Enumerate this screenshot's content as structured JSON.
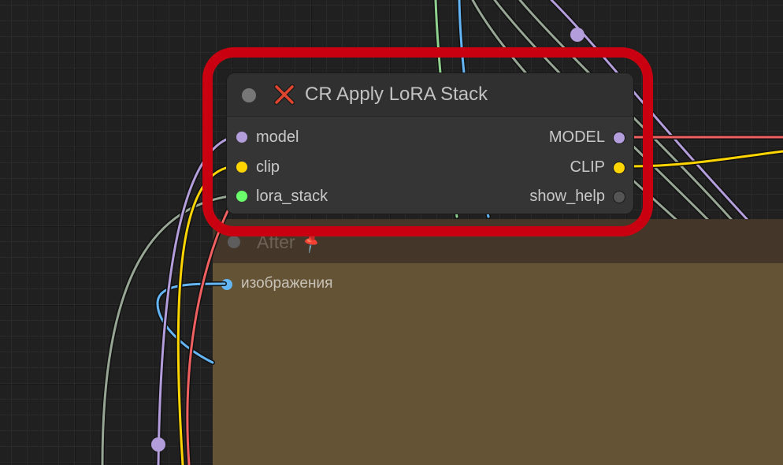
{
  "canvas": {
    "background": "#202020",
    "highlight_color": "#c8000f"
  },
  "node_lora": {
    "title": "CR Apply LoRA Stack",
    "title_icon": "red-x-icon",
    "inputs": [
      {
        "label": "model",
        "color": "#b39ddb"
      },
      {
        "label": "clip",
        "color": "#ffd500"
      },
      {
        "label": "lora_stack",
        "color": "#6bff6b"
      }
    ],
    "outputs": [
      {
        "label": "MODEL",
        "color": "#b39ddb"
      },
      {
        "label": "CLIP",
        "color": "#ffd500"
      },
      {
        "label": "show_help",
        "color": "#555555"
      }
    ]
  },
  "node_after": {
    "title": "After",
    "title_icon": "pushpin-icon",
    "inputs": [
      {
        "label": "изображения",
        "color": "#64b5f6"
      }
    ]
  }
}
